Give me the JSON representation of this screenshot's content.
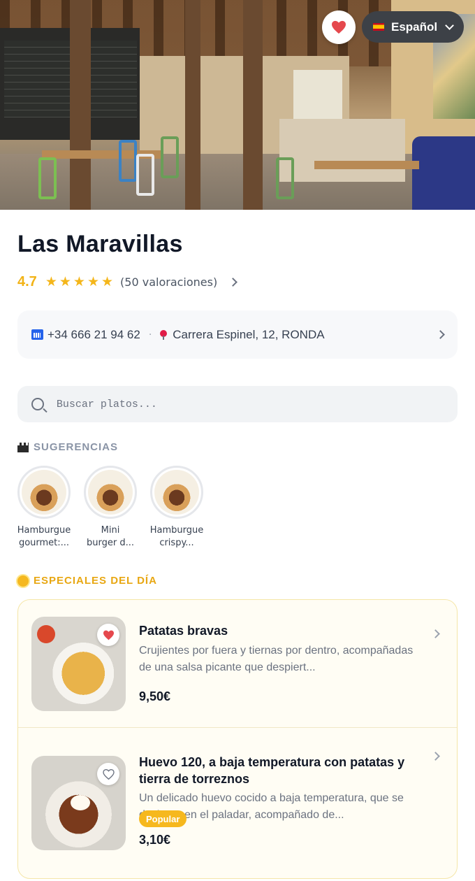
{
  "header": {
    "language_label": "Español",
    "icons": {
      "favorite": "heart-icon",
      "language_flag": "spain-flag-icon",
      "dropdown": "chevron-down-icon"
    }
  },
  "restaurant": {
    "name": "Las Maravillas",
    "rating": "4.7",
    "stars": 5,
    "reviews_label": "(50 valoraciones)",
    "phone": "+34 666 21 94 62",
    "address": "Carrera Espinel, 12, RONDA"
  },
  "search": {
    "placeholder": "Buscar platos..."
  },
  "suggestions": {
    "heading": "SUGERENCIAS",
    "items": [
      {
        "name": "Hamburgue\ngourmet:..."
      },
      {
        "name": "Mini\nburger d..."
      },
      {
        "name": "Hamburgue\ncrispy..."
      }
    ]
  },
  "specials": {
    "heading": "ESPECIALES DEL DÍA",
    "items": [
      {
        "title": "Patatas bravas",
        "description": "Crujientes por fuera y tiernas por dentro, acompañadas de una salsa picante que despiert...",
        "price": "9,50€",
        "favorited": true
      },
      {
        "title": "Huevo 120, a baja temperatura con patatas y tierra de torreznos",
        "description": "Un delicado huevo cocido a baja temperatura, que se deshace en el paladar, acompañado de...",
        "badge": "Popular",
        "price": "3,10€",
        "favorited": false
      }
    ]
  },
  "colors": {
    "accent": "#f2b316",
    "favorite": "#e5484d",
    "badge": "#f6b81e"
  }
}
